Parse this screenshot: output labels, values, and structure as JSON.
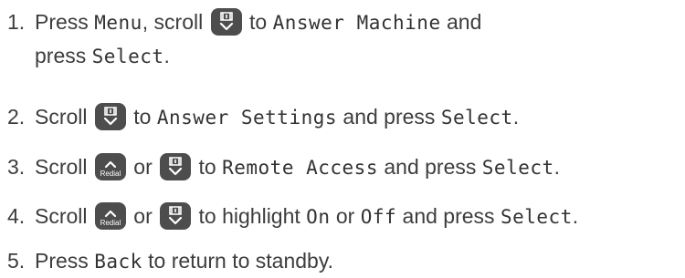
{
  "steps": [
    {
      "num": "1.",
      "t1": "Press ",
      "lcd1": "Menu",
      "t2": ", scroll ",
      "t3": " to ",
      "lcd2": "Answer Machine",
      "t4": " and",
      "t5": "press ",
      "lcd3": "Select",
      "t6": "."
    },
    {
      "num": "2.",
      "t1": "Scroll ",
      "t2": " to ",
      "lcd1": "Answer Settings",
      "t3": " and press ",
      "lcd2": "Select",
      "t4": "."
    },
    {
      "num": "3.",
      "t1": "Scroll ",
      "t2": " or ",
      "t3": " to ",
      "lcd1": "Remote Access",
      "t4": " and press ",
      "lcd2": "Select",
      "t5": "."
    },
    {
      "num": "4.",
      "t1": "Scroll ",
      "t2": " or ",
      "t3": " to highlight ",
      "lcd1": "On",
      "t4": " or ",
      "lcd2": "Off",
      "t5": " and press ",
      "lcd3": "Select",
      "t6": "."
    },
    {
      "num": "5.",
      "t1": "Press ",
      "lcd1": "Back",
      "t2": " to return to standby."
    }
  ],
  "keys": {
    "redial_label": "Redial",
    "key_color": "#4d4d4d"
  }
}
